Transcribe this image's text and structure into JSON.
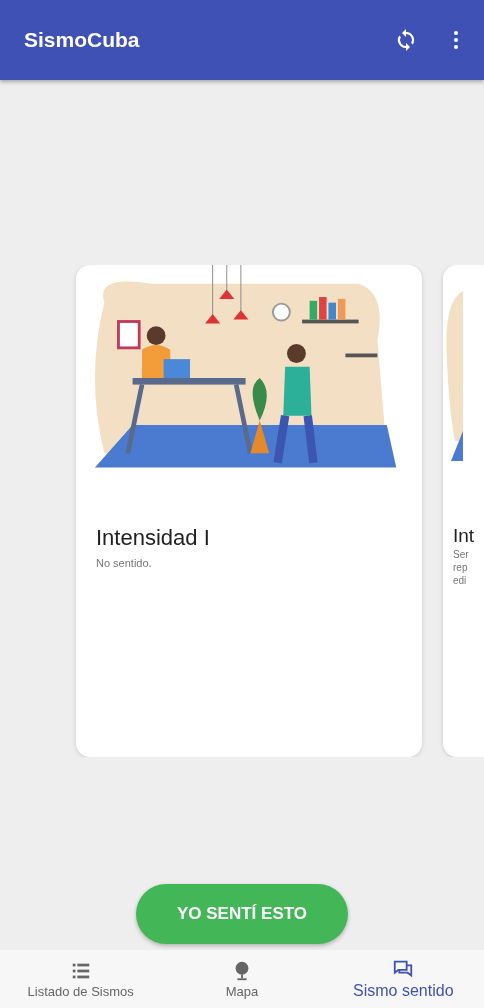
{
  "app_bar": {
    "title": "SismoCuba"
  },
  "cards": [
    {
      "title": "Intensidad I",
      "lines": [
        "No sentido."
      ]
    },
    {
      "title": "Int",
      "lines": [
        "Ser",
        "rep",
        "edi"
      ]
    }
  ],
  "action_button": {
    "label": "YO SENTÍ ESTO"
  },
  "bottom_nav": [
    {
      "label": "Listado de Sismos",
      "kind": "list",
      "selected": false
    },
    {
      "label": "Mapa",
      "kind": "globe",
      "selected": false
    },
    {
      "label": "Sismo sentido",
      "kind": "chat",
      "selected": true
    }
  ]
}
